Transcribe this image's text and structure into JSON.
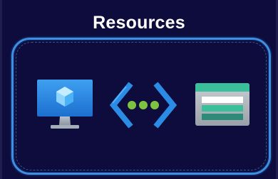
{
  "title": "Resources",
  "icons": [
    {
      "name": "virtual-machine-icon"
    },
    {
      "name": "virtual-network-icon"
    },
    {
      "name": "storage-account-icon"
    }
  ],
  "colors": {
    "background": "#0d0c3c",
    "border": "#3d8fe6",
    "accent_blue": "#2a8ce4",
    "green": "#7dc242",
    "storage_header": "#3bbf9b"
  }
}
